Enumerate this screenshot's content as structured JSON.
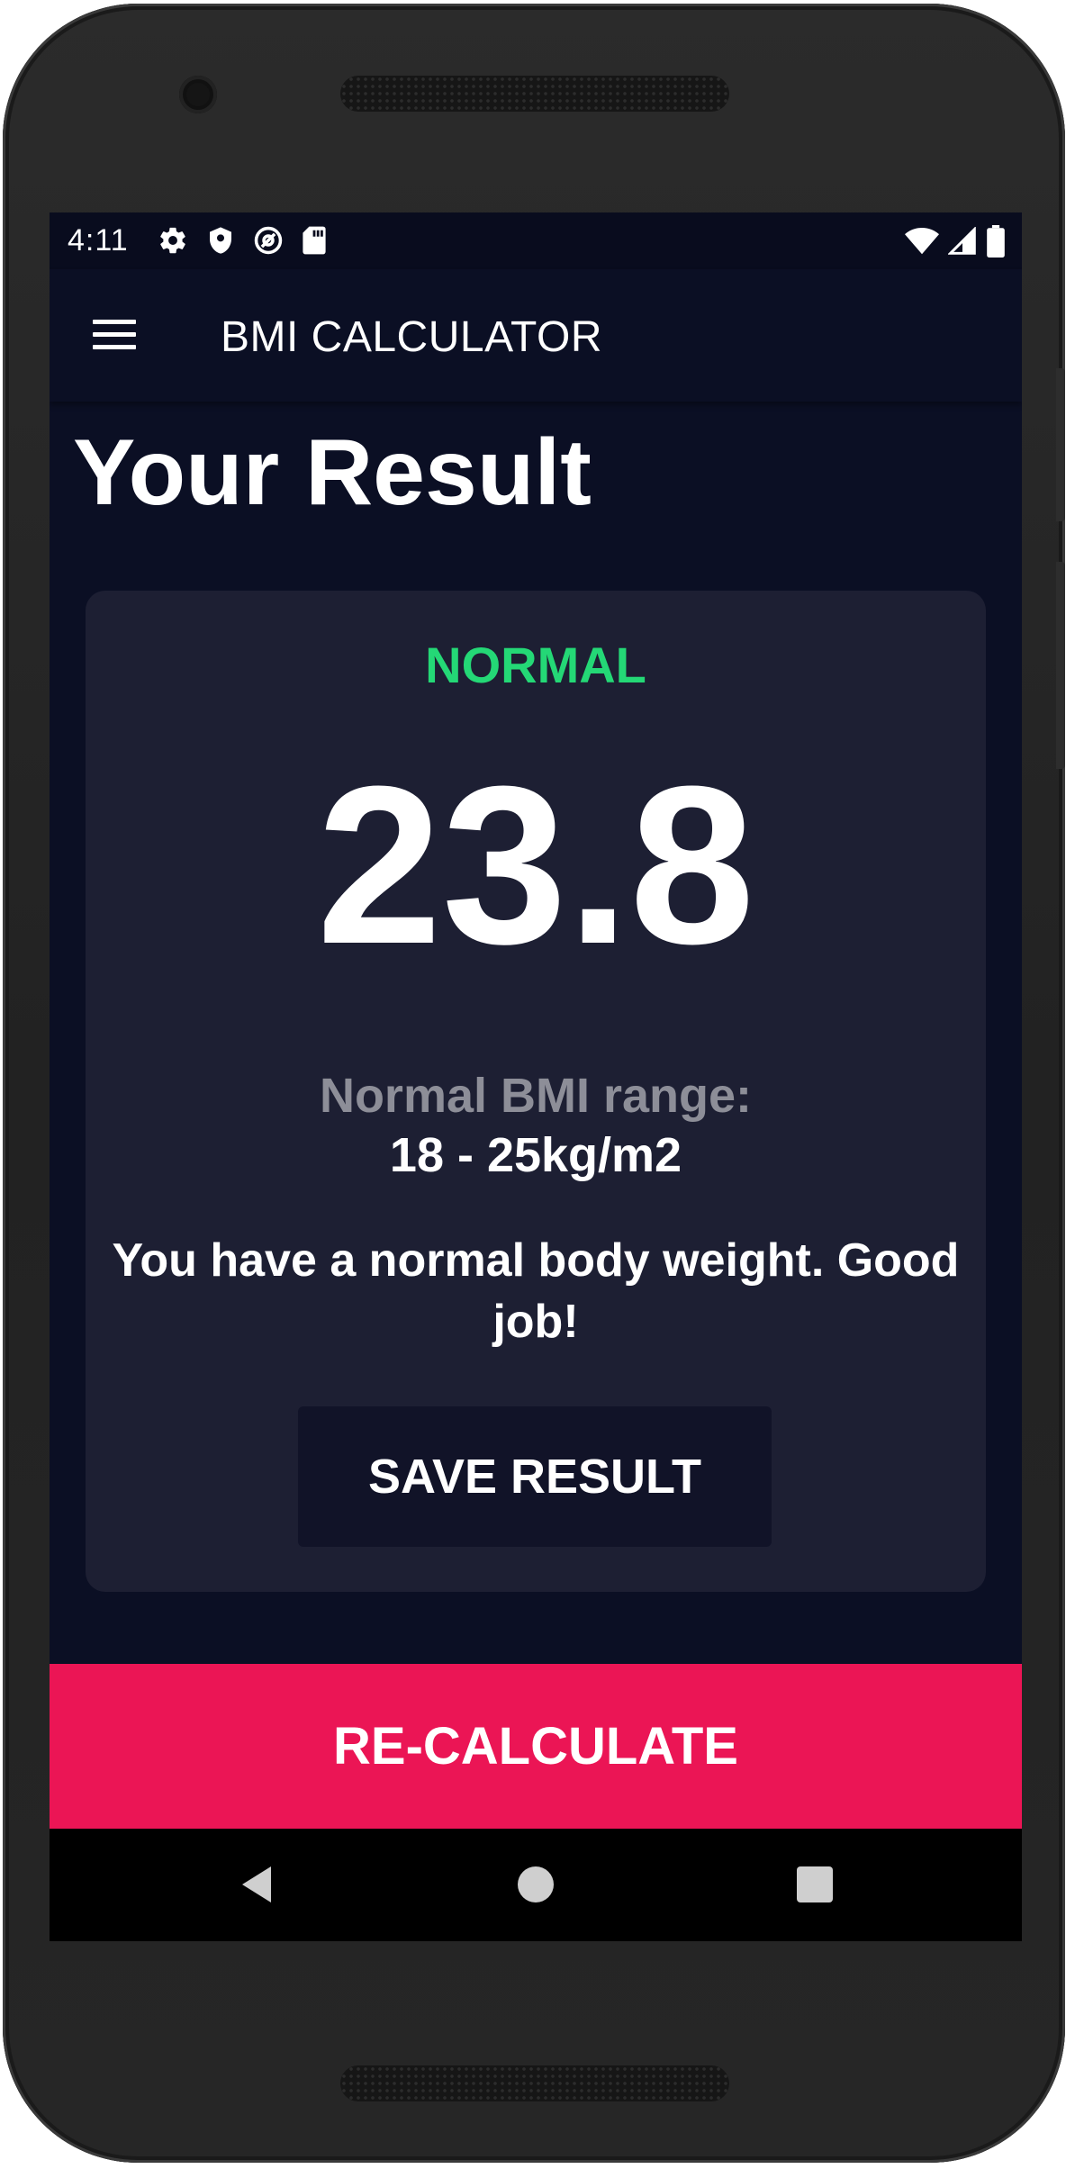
{
  "status_bar": {
    "time": "4:11",
    "left_icons": [
      "gear-icon",
      "shield-icon",
      "at-sign-icon",
      "sd-card-icon"
    ],
    "right_icons": [
      "wifi-icon",
      "signal-icon",
      "battery-icon"
    ]
  },
  "app_bar": {
    "title": "BMI CALCULATOR",
    "menu_icon": "menu-icon"
  },
  "page": {
    "title": "Your Result"
  },
  "result": {
    "status": "NORMAL",
    "bmi_value": "23.8",
    "range_label": "Normal BMI range:",
    "range_value": "18 - 25kg/m2",
    "interpretation": "You have a normal body weight. Good job!",
    "save_label": "SAVE RESULT"
  },
  "recalculate_label": "RE-CALCULATE",
  "nav_bar": {
    "icons": [
      "back-icon",
      "home-icon",
      "recents-icon"
    ]
  },
  "colors": {
    "background": "#0b0f24",
    "card": "#1d1f33",
    "status_normal": "#24d876",
    "accent": "#eb1555",
    "muted_text": "#8d8e98"
  }
}
